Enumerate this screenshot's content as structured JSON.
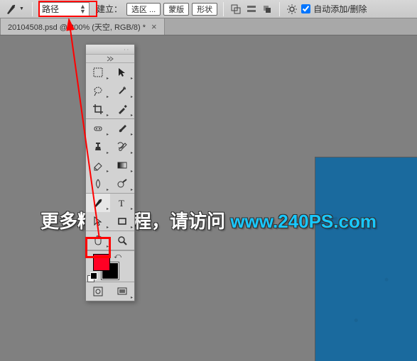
{
  "options_bar": {
    "mode_select_value": "路径",
    "create_label": "建立：",
    "btn_selection": "选区 ...",
    "btn_mask": "蒙版",
    "btn_shape": "形状",
    "auto_add_remove_label": "自动添加/删除"
  },
  "doc_tab": {
    "title": "20104508.psd @ 200% (天空, RGB/8) *"
  },
  "tools": {
    "move": "move-tool",
    "rect_marquee": "rectangular-marquee-tool",
    "lasso": "lasso-tool",
    "magic_wand": "magic-wand-tool",
    "crop": "crop-tool",
    "eyedropper": "eyedropper-tool",
    "spot_heal": "spot-healing-brush-tool",
    "brush": "brush-tool",
    "clone": "clone-stamp-tool",
    "history_brush": "history-brush-tool",
    "eraser": "eraser-tool",
    "gradient": "gradient-tool",
    "blur": "blur-tool",
    "dodge": "dodge-tool",
    "pen": "pen-tool",
    "type": "type-tool",
    "path_sel": "path-selection-tool",
    "shape": "rectangle-shape-tool",
    "hand": "hand-tool",
    "zoom": "zoom-tool",
    "quick_mask": "quick-mask-mode",
    "screen_mode": "screen-mode"
  },
  "colors": {
    "foreground": "#ff0024",
    "background": "#000000",
    "canvas_blue": "#1a6a9e",
    "accent_red": "#ff0000"
  },
  "watermark": {
    "text_cn": "更多精品教程，请访问 ",
    "url": "www.240PS.com"
  }
}
